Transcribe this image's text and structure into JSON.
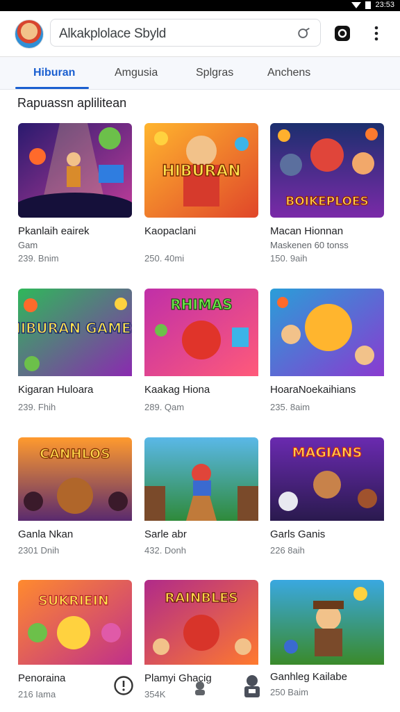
{
  "status": {
    "time": "23:53"
  },
  "app_bar": {
    "search_text": "Alkakplolace Sbyld",
    "icons": [
      "avatar",
      "search-icon",
      "app-icon",
      "more-vert-icon"
    ]
  },
  "tabs": [
    {
      "label": "Hiburan",
      "active": true
    },
    {
      "label": "Amgusia",
      "active": false
    },
    {
      "label": "Splgras",
      "active": false
    },
    {
      "label": "Anchens",
      "active": false
    }
  ],
  "section": {
    "title": "Rapuassn aplilitean"
  },
  "cards": [
    {
      "title": "Pkanlaih eairek",
      "subtitle": "Gam",
      "meta": "239. Bnim",
      "thumb_text": ""
    },
    {
      "title": "Kaopaclani",
      "subtitle": "",
      "meta": "250. 40mi",
      "thumb_text": "HIBURAN"
    },
    {
      "title": "Macan Hionnan",
      "subtitle": "Maskenen 60 tonss",
      "meta": "150. 9aih",
      "thumb_text": "BOIKEPLOES"
    },
    {
      "title": "Kigaran Huloara",
      "subtitle": "",
      "meta": "239. Fhih",
      "thumb_text": "HIBURAN GAMES"
    },
    {
      "title": "Kaakag Hiona",
      "subtitle": "",
      "meta": "289. Qam",
      "thumb_text": "RHIMAS"
    },
    {
      "title": "HoaraNoekaihians",
      "subtitle": "",
      "meta": "235. 8aim",
      "thumb_text": ""
    },
    {
      "title": "Ganla Nkan",
      "subtitle": "",
      "meta": "2301 Dnih",
      "thumb_text": "CANHLOS"
    },
    {
      "title": "Sarle abr",
      "subtitle": "",
      "meta": "432. Donh",
      "thumb_text": ""
    },
    {
      "title": "Garls Ganis",
      "subtitle": "",
      "meta": "226 8aih",
      "thumb_text": "MAGIANS"
    },
    {
      "title": "Penoraina",
      "subtitle": "",
      "meta": "216 Iama",
      "thumb_text": "SUKRIEIN"
    },
    {
      "title": "Plamyi Ghacig",
      "subtitle": "",
      "meta": "354K",
      "thumb_text": "RAINBLES"
    },
    {
      "title": "Ganhleg Kailabe",
      "subtitle": "",
      "meta": "250 Baim",
      "thumb_text": ""
    }
  ]
}
